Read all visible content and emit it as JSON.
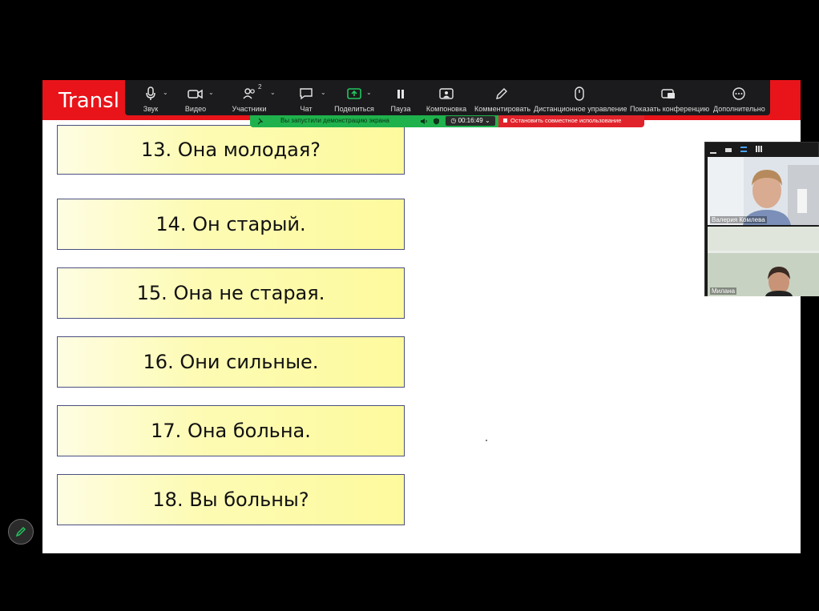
{
  "slide": {
    "title": "Transl",
    "cards": [
      {
        "text": "13. Она молодая?"
      },
      {
        "text": "14. Он старый."
      },
      {
        "text": "15. Она не старая."
      },
      {
        "text": "16. Они сильные."
      },
      {
        "text": "17. Она больна."
      },
      {
        "text": "18. Вы больны?"
      }
    ]
  },
  "toolbar": {
    "items": [
      {
        "label": "Звук",
        "icon": "microphone-icon"
      },
      {
        "label": "Видео",
        "icon": "video-camera-icon"
      },
      {
        "label": "Участники",
        "icon": "participants-icon",
        "count": "2"
      },
      {
        "label": "Чат",
        "icon": "chat-icon"
      },
      {
        "label": "Поделиться",
        "icon": "share-screen-icon"
      },
      {
        "label": "Пауза",
        "icon": "pause-icon"
      },
      {
        "label": "Компоновка",
        "icon": "layout-icon"
      },
      {
        "label": "Комментировать",
        "icon": "pencil-icon"
      },
      {
        "label": "Дистанционное управление",
        "icon": "mouse-icon"
      },
      {
        "label": "Показать конференцию",
        "icon": "show-meeting-icon"
      },
      {
        "label": "Дополнительно",
        "icon": "more-icon"
      }
    ],
    "accent_color": "#22c55e"
  },
  "share_status": {
    "text": "Вы запустили демонстрацию экрана",
    "timer": "00:16:49",
    "stop_label": "Остановить совместное использование",
    "bar_color": "#1fb24c",
    "stop_color": "#e0232b"
  },
  "video_panel": {
    "participants": [
      {
        "name": "Валерия Комлева"
      },
      {
        "name": "Милана"
      }
    ]
  }
}
